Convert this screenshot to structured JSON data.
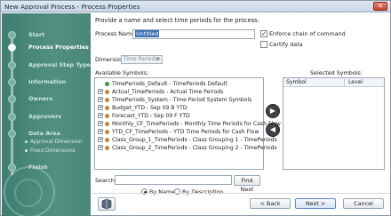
{
  "window": {
    "title": "New Approval Process - Process Properties",
    "close_label": "✕"
  },
  "wizard": {
    "steps": [
      {
        "label": "Start"
      },
      {
        "label": "Process Properties"
      },
      {
        "label": "Approval Step Type"
      },
      {
        "label": "Information"
      },
      {
        "label": "Owners"
      },
      {
        "label": "Approvers"
      },
      {
        "label": "Data Area"
      },
      {
        "label": "Finish"
      }
    ],
    "substeps": [
      {
        "label": "Approval Dimension"
      },
      {
        "label": "Fixed Dimensions"
      }
    ]
  },
  "form": {
    "heading": "Provide a name and select time periods for the process:",
    "process_name_label": "Process Name:",
    "process_name_value": "Untitled",
    "enforce_label": "Enforce chain of command",
    "enforce_checked": "✓",
    "certify_label": "Certify data",
    "dimension_label": "Dimension:",
    "dimension_value": "Time Periods",
    "available_label": "Available Symbols:",
    "selected_label": "Selected Symbols:",
    "selected_columns": [
      "Symbol",
      "Level"
    ],
    "symbols": [
      {
        "expander": "",
        "label": "TimePeriods_Default - TimePeriods Default",
        "color": "#3d9a3a"
      },
      {
        "expander": "+",
        "label": "Actual_TimePeriods - Actual Time Periods",
        "color": "#b58a3a"
      },
      {
        "expander": "+",
        "label": "TimePeriods_System - Time Period System Symbols",
        "color": "#b58a3a"
      },
      {
        "expander": "+",
        "label": "Budget_YTD - Sep 09 B YTD",
        "color": "#b58a3a"
      },
      {
        "expander": "+",
        "label": "Forecast_YTD - Sep 09 F YTD",
        "color": "#b58a3a"
      },
      {
        "expander": "+",
        "label": "Monthly_CF_TimePeriods - Monthly Time Periods for Cash Flow",
        "color": "#b58a3a"
      },
      {
        "expander": "+",
        "label": "YTD_CF_TimePeriods - YTD Time Periods for Cash Flow",
        "color": "#b58a3a"
      },
      {
        "expander": "+",
        "label": "Class_Group_1_TimePeriods - Class Grouping 1 - TimePeriods",
        "color": "#b58a3a"
      },
      {
        "expander": "+",
        "label": "Class_Group_2_TimePeriods - Class Grouping 2 - TimePeriods",
        "color": "#b58a3a"
      }
    ],
    "add_arrow": "▶",
    "remove_arrow": "◀",
    "search_label": "Search:",
    "search_value": "",
    "find_next_label": "Find Next",
    "radio_by_name": "By Name",
    "radio_by_description": "By Description"
  },
  "footer": {
    "back_label": "< Back",
    "next_label": "Next >",
    "cancel_label": "Cancel",
    "help_icon": "book-icon"
  }
}
